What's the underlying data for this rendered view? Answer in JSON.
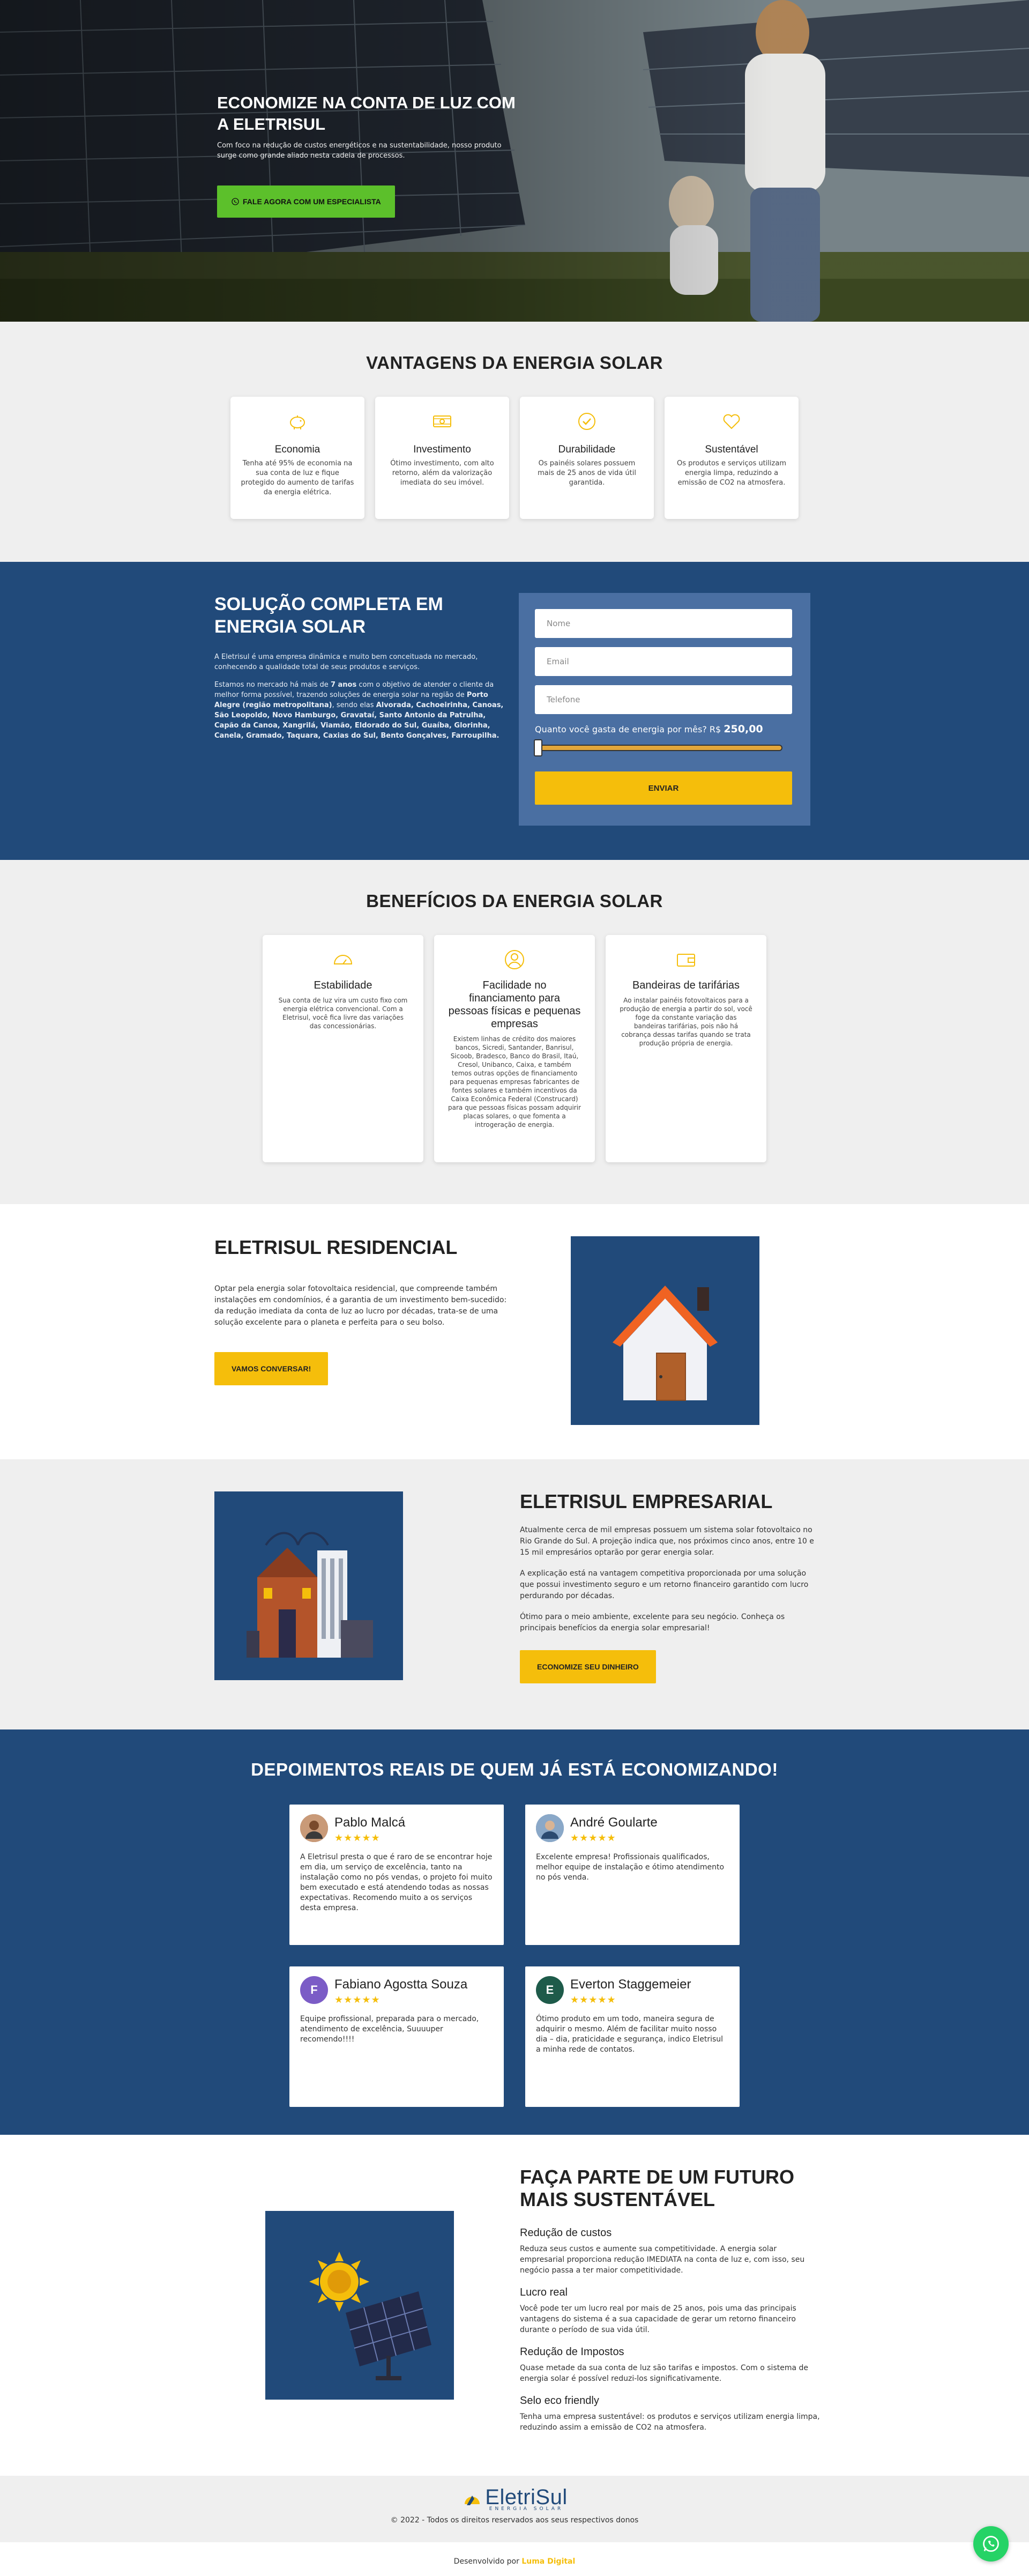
{
  "hero": {
    "title": "ECONOMIZE NA CONTA DE LUZ COM A ELETRISUL",
    "subtitle": "Com foco na redução de custos energéticos e na sustentabilidade, nosso produto surge como grande aliado nesta cadeia de processos.",
    "cta": "FALE AGORA COM UM ESPECIALISTA"
  },
  "vantagens": {
    "title": "VANTAGENS DA ENERGIA SOLAR",
    "cards": [
      {
        "icon": "piggy-bank-icon",
        "title": "Economia",
        "text": "Tenha até 95% de economia na sua conta de luz e fique protegido do aumento de tarifas da energia elétrica."
      },
      {
        "icon": "money-bill-icon",
        "title": "Investimento",
        "text": "Ótimo investimento, com alto retorno, além da valorização imediata do seu imóvel."
      },
      {
        "icon": "check-circle-icon",
        "title": "Durabilidade",
        "text": "Os painéis solares possuem mais de 25 anos de vida útil garantida."
      },
      {
        "icon": "heart-icon",
        "title": "Sustentável",
        "text": "Os produtos e serviços utilizam energia limpa, reduzindo a emissão de CO2 na atmosfera."
      }
    ]
  },
  "solucao": {
    "title": "SOLUÇÃO COMPLETA EM ENERGIA SOLAR",
    "p1": "A Eletrisul é uma empresa dinâmica e muito bem conceituada no mercado, conhecendo a qualidade total de seus produtos e serviços.",
    "p2_start": "Estamos no mercado há mais de ",
    "p2_years": "7 anos",
    "p2_mid": " com o objetivo de atender o cliente da melhor forma possível, trazendo soluções de energia solar na região de ",
    "p2_region": "Porto Alegre (região metropolitana)",
    "p2_mid2": ", sendo elas ",
    "p2_cities": "Alvorada, Cachoeirinha, Canoas, São Leopoldo, Novo Hamburgo, Gravataí, Santo Antonio da Patrulha, Capão da Canoa, Xangrilá, Viamão, Eldorado do Sul, Guaíba, Glorinha, Canela, Gramado, Taquara, Caxias do Sul, Bento Gonçalves, Farroupilha.",
    "form": {
      "name_placeholder": "Nome",
      "email_placeholder": "Email",
      "phone_placeholder": "Telefone",
      "slider_label": "Quanto você gasta de energia por mês? R$",
      "slider_value": "250,00",
      "submit": "ENVIAR"
    }
  },
  "beneficios": {
    "title": "BENEFÍCIOS DA ENERGIA SOLAR",
    "cards": [
      {
        "icon": "gauge-icon",
        "title": "Estabilidade",
        "text": "Sua conta de luz vira um custo fixo com energia elétrica convencional. Com a Eletrisul, você fica livre das variações das concessionárias."
      },
      {
        "icon": "user-circle-icon",
        "title": "Facilidade no financiamento para pessoas físicas e pequenas empresas",
        "text": "Existem linhas de crédito dos maiores bancos, Sicredi, Santander, Banrisul, Sicoob, Bradesco, Banco do Brasil, Itaú, Cresol, Unibanco, Caixa, e também temos outras opções de financiamento para pequenas empresas fabricantes de fontes solares e também incentivos da Caixa Econômica Federal (Construcard) para que pessoas físicas possam adquirir placas solares, o que fomenta a introgeração de energia."
      },
      {
        "icon": "wallet-icon",
        "title": "Bandeiras de tarifárias",
        "text": "Ao instalar painéis fotovoltaicos para a produção de energia a partir do sol, você foge da constante variação das bandeiras tarifárias, pois não há cobrança dessas tarifas quando se trata produção própria de energia."
      }
    ]
  },
  "residencial": {
    "title": "ELETRISUL RESIDENCIAL",
    "text": "Optar pela energia solar fotovoltaica residencial, que compreende também instalações em condomínios, é a garantia de um investimento bem-sucedido: da redução imediata da conta de luz ao lucro por décadas, trata-se de uma solução excelente para o planeta e perfeita para o seu bolso.",
    "cta": "VAMOS CONVERSAR!"
  },
  "empresarial": {
    "title": "ELETRISUL EMPRESARIAL",
    "p1": "Atualmente cerca de mil empresas possuem um sistema solar fotovoltaico no Rio Grande do Sul. A projeção indica que, nos próximos cinco anos, entre 10 e 15 mil empresários optarão por gerar energia solar.",
    "p2": "A explicação está na vantagem competitiva proporcionada por uma solução que possui investimento seguro e um retorno financeiro garantido com lucro perdurando por décadas.",
    "p3": "Ótimo para o meio ambiente, excelente para seu negócio. Conheça os principais benefícios da energia solar empresarial!",
    "cta": "ECONOMIZE SEU DINHEIRO"
  },
  "depoimentos": {
    "title": "DEPOIMENTOS REAIS DE QUEM JÁ ESTÁ ECONOMIZANDO!",
    "items": [
      {
        "name": "Pablo Malcá",
        "initial": "",
        "avatar_color": "#8a5a3c",
        "stars": "★★★★★",
        "text": "A Eletrisul presta o que é raro de se encontrar hoje em dia, um serviço de excelência, tanto na instalação como no pós vendas, o projeto foi muito bem executado e está atendendo todas as nossas expectativas. Recomendo muito a os serviços desta empresa."
      },
      {
        "name": "André Goularte",
        "initial": "",
        "avatar_color": "#5b7fa6",
        "stars": "★★★★★",
        "text": "Excelente empresa! Profissionais qualificados, melhor equipe de instalação e ótimo atendimento no pós venda."
      },
      {
        "name": "Fabiano Agostta Souza",
        "initial": "F",
        "avatar_color": "#7b5cc6",
        "stars": "★★★★★",
        "text": "Equipe profissional, preparada para o mercado, atendimento de excelência, Suuuuper recomendo!!!!"
      },
      {
        "name": "Everton Staggemeier",
        "initial": "E",
        "avatar_color": "#1e5b4a",
        "stars": "★★★★★",
        "text": "Ótimo produto em um todo, maneira segura de adquirir o mesmo. Além de facilitar muito nosso dia – dia, praticidade e segurança, indico Eletrisul a minha rede de contatos."
      }
    ]
  },
  "sustentavel": {
    "title": "FAÇA PARTE DE UM FUTURO MAIS SUSTENTÁVEL",
    "items": [
      {
        "title": "Redução de custos",
        "text": "Reduza seus custos e aumente sua competitividade. A energia solar empresarial proporciona redução IMEDIATA na conta de luz e, com isso, seu negócio passa a ter maior competitividade."
      },
      {
        "title": "Lucro real",
        "text": "Você pode ter um lucro real por mais de 25 anos, pois uma das principais vantagens do sistema é a sua capacidade de gerar um retorno financeiro durante o período de sua vida útil."
      },
      {
        "title": "Redução de Impostos",
        "text": "Quase metade da sua conta de luz são tarifas e impostos. Com o sistema de energia solar é possível reduzi-los significativamente."
      },
      {
        "title": "Selo eco friendly",
        "text": "Tenha uma empresa sustentável: os produtos e serviços utilizam energia limpa, reduzindo assim a emissão de CO2 na atmosfera."
      }
    ]
  },
  "footer": {
    "logo_text": "EletriSul",
    "logo_sub": "ENERGIA SOLAR",
    "copyright": "© 2022 - Todos os direitos reservados aos seus respectivos donos",
    "dev_prefix": "Desenvolvido por ",
    "dev_brand": "Luma Digital"
  },
  "colors": {
    "primary": "#214a7a",
    "accent": "#f5be0b",
    "green": "#5cc02b",
    "whatsapp": "#25d366"
  }
}
